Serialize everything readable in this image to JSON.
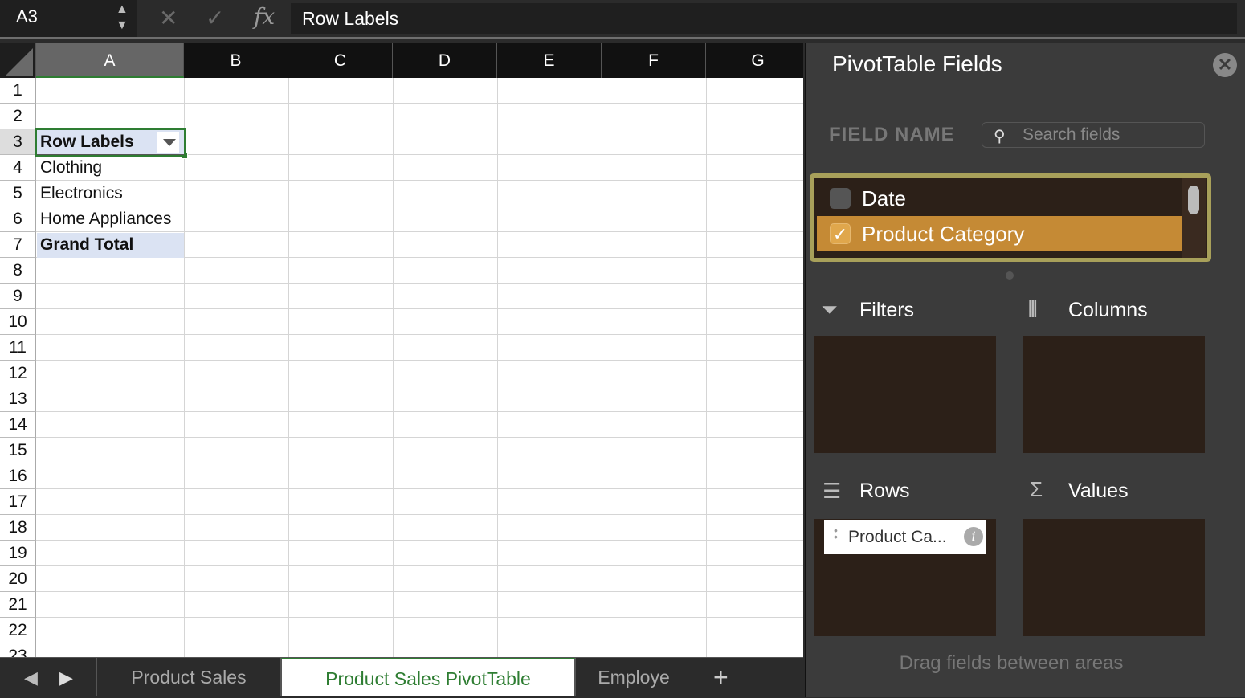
{
  "formula_bar": {
    "cell_ref": "A3",
    "cancel_icon": "✕",
    "confirm_icon": "✓",
    "fx_label": "fx",
    "formula": "Row Labels"
  },
  "columns": [
    "A",
    "B",
    "C",
    "D",
    "E",
    "F",
    "G"
  ],
  "rows": [
    "1",
    "2",
    "3",
    "4",
    "5",
    "6",
    "7",
    "8",
    "9",
    "10",
    "11",
    "12",
    "13",
    "14",
    "15",
    "16",
    "17",
    "18",
    "19",
    "20",
    "21",
    "22",
    "23"
  ],
  "pivot": {
    "header": "Row Labels",
    "items": [
      "Clothing",
      "Electronics",
      "Home Appliances"
    ],
    "total": "Grand Total"
  },
  "sheet_tabs": {
    "tabs": [
      "Product Sales",
      "Product Sales PivotTable",
      "Employe"
    ],
    "active": "Product Sales PivotTable",
    "add": "+"
  },
  "panel": {
    "title": "PivotTable Fields",
    "field_name_label": "FIELD NAME",
    "search_placeholder": "Search fields",
    "fields": [
      {
        "name": "Date",
        "checked": false
      },
      {
        "name": "Product Category",
        "checked": true
      }
    ],
    "areas": {
      "filters": "Filters",
      "columns": "Columns",
      "rows": "Rows",
      "values": "Values"
    },
    "rows_pill": "Product Ca...",
    "hint": "Drag fields between areas"
  },
  "colors": {
    "accent_green": "#2e7d32",
    "field_checked": "#c58a35",
    "field_list_border": "#a8a05a"
  }
}
